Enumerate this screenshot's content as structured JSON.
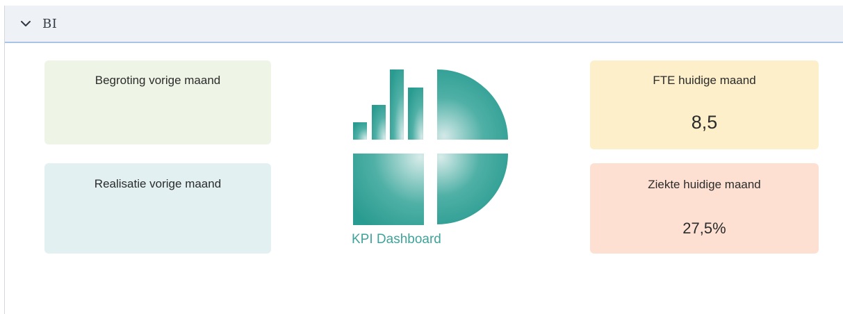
{
  "panel": {
    "title": "BI",
    "collapse_icon": "chevron-down-icon"
  },
  "tiles": {
    "begroting": {
      "label": "Begroting vorige maand",
      "value": "",
      "color": "#eef5e6"
    },
    "realisatie": {
      "label": "Realisatie vorige maand",
      "value": "",
      "color": "#e2f0f1"
    },
    "fte": {
      "label": "FTE huidige maand",
      "value": "8,5",
      "color": "#fcefc9"
    },
    "ziekte": {
      "label": "Ziekte huidige maand",
      "value": "27,5%",
      "color": "#fde0d1"
    }
  },
  "logo": {
    "text": "KPI Dashboard",
    "icon": "kpi-dashboard-logo-icon",
    "color": "#3fa39a"
  }
}
